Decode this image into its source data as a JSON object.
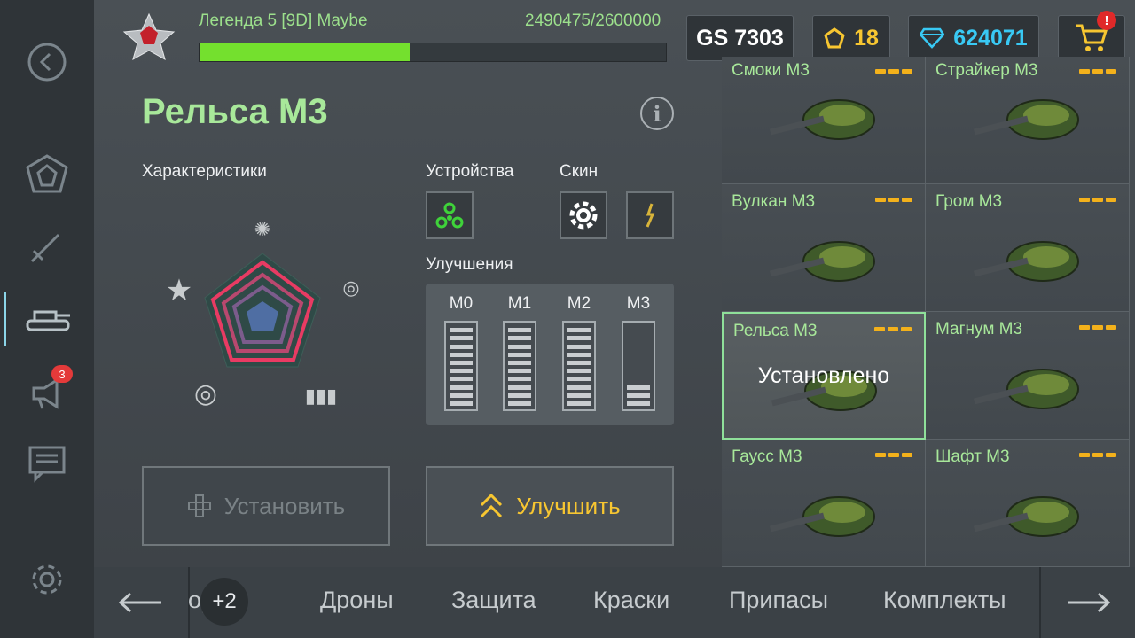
{
  "header": {
    "rank_name": "Легенда 5 [9D] Maybe",
    "xp_text": "2490475/2600000",
    "xp_progress": 0.45,
    "gs": "GS 7303",
    "crystals_icon": "pentagon-crystal-icon",
    "crystals": "18",
    "diamonds": "624071",
    "shop_badge": "!"
  },
  "sidebar": {
    "items": [
      {
        "name": "back"
      },
      {
        "name": "garage-emblem"
      },
      {
        "name": "weapons"
      },
      {
        "name": "hulls"
      },
      {
        "name": "announcements",
        "badge": "3"
      },
      {
        "name": "chat"
      },
      {
        "name": "settings"
      }
    ]
  },
  "details": {
    "title": "Рельса М3",
    "characteristics_label": "Характеристики",
    "devices_label": "Устройства",
    "skin_label": "Скин",
    "upgrades_label": "Улучшения",
    "upgrades": [
      {
        "label": "М0",
        "filled": 10,
        "total": 10
      },
      {
        "label": "М1",
        "filled": 10,
        "total": 10
      },
      {
        "label": "М2",
        "filled": 10,
        "total": 10
      },
      {
        "label": "М3",
        "filled": 3,
        "total": 10
      }
    ],
    "install_label": "Установить",
    "upgrade_label": "Улучшить"
  },
  "items": [
    {
      "name": "Смоки М3",
      "selected": false
    },
    {
      "name": "Страйкер М3",
      "selected": false
    },
    {
      "name": "Вулкан М3",
      "selected": false
    },
    {
      "name": "Гром М3",
      "selected": false
    },
    {
      "name": "Рельса М3",
      "selected": true,
      "status": "Установлено"
    },
    {
      "name": "Магнум М3",
      "selected": false
    },
    {
      "name": "Гаусс М3",
      "selected": false
    },
    {
      "name": "Шафт М3",
      "selected": false
    }
  ],
  "bottom_tabs": {
    "plus_badge": "+2",
    "partial_tab": "орса",
    "tabs": [
      "Дроны",
      "Защита",
      "Краски",
      "Припасы",
      "Комплекты"
    ]
  },
  "colors": {
    "accent_green": "#a8e89a",
    "xp_fill": "#74e02e",
    "gold": "#f7c631",
    "diamond": "#39c9f4"
  }
}
